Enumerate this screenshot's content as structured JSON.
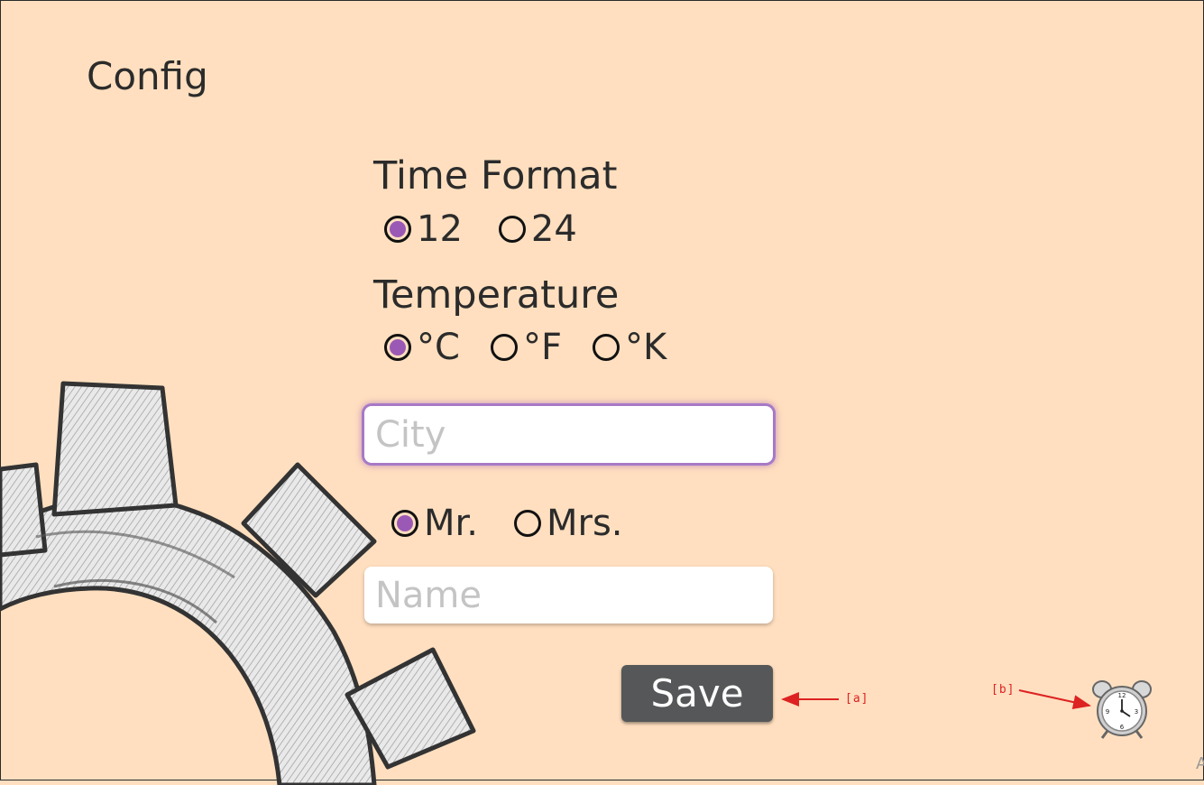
{
  "page": {
    "title": "Config"
  },
  "time_format": {
    "label": "Time Format",
    "options": [
      {
        "label": "12",
        "checked": true
      },
      {
        "label": "24",
        "checked": false
      }
    ]
  },
  "temperature": {
    "label": "Temperature",
    "options": [
      {
        "label": "°C",
        "checked": true
      },
      {
        "label": "°F",
        "checked": false
      },
      {
        "label": "°K",
        "checked": false
      }
    ]
  },
  "city": {
    "placeholder": "City",
    "value": ""
  },
  "title_choice": {
    "options": [
      {
        "label": "Mr.",
        "checked": true
      },
      {
        "label": "Mrs.",
        "checked": false
      }
    ]
  },
  "name": {
    "placeholder": "Name",
    "value": ""
  },
  "save": {
    "label": "Save"
  },
  "annotations": {
    "a": "[a]",
    "b": "[b]"
  },
  "icons": {
    "background": "gear-icon",
    "alarm": "alarm-clock-icon"
  },
  "colors": {
    "background": "#ffdfbf",
    "accent": "#9b59b6",
    "button": "#555759",
    "annotation": "#dd2222"
  },
  "corner_text": "A"
}
